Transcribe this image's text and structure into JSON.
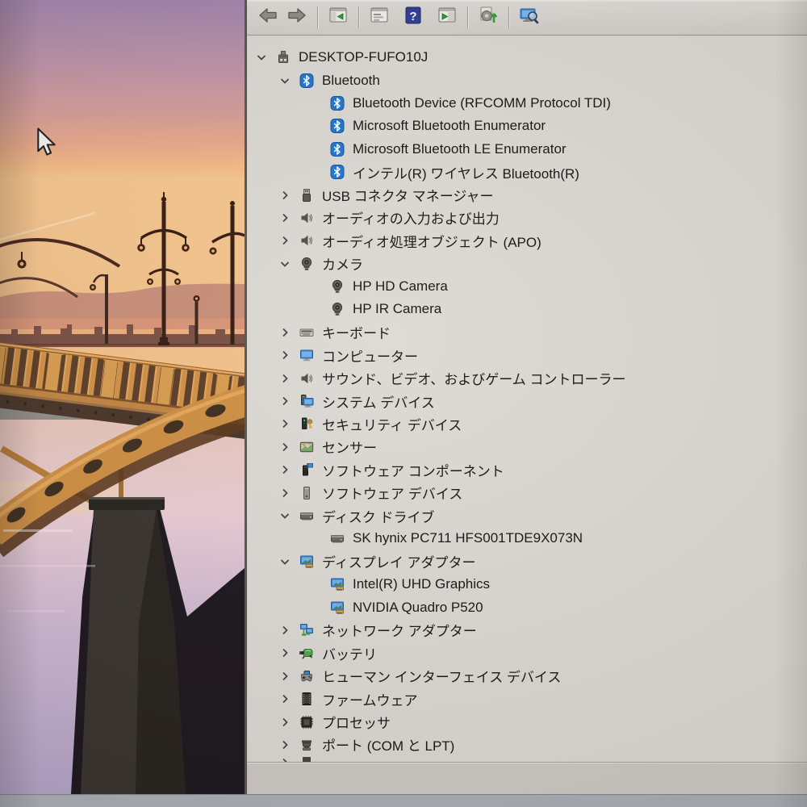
{
  "window": {
    "app": "device-manager"
  },
  "colors": {
    "bluetooth_blue": "#1b74cf",
    "monitor_blue": "#3584d6",
    "help_blue": "#2d3a96",
    "battery_green": "#4aa84a",
    "tree_background": "#dcd9d4"
  },
  "toolbar": {
    "items": [
      {
        "type": "button",
        "name": "back-button",
        "icon": "arrow-left"
      },
      {
        "type": "button",
        "name": "forward-button",
        "icon": "arrow-right"
      },
      {
        "type": "sep"
      },
      {
        "type": "button",
        "name": "console-tree-button",
        "icon": "console-tree"
      },
      {
        "type": "sep"
      },
      {
        "type": "button",
        "name": "properties-button",
        "icon": "properties-window"
      },
      {
        "type": "button",
        "name": "help-button",
        "icon": "help"
      },
      {
        "type": "button",
        "name": "action-pane-button",
        "icon": "action-pane"
      },
      {
        "type": "sep"
      },
      {
        "type": "button",
        "name": "scan-hardware-button",
        "icon": "scan-hardware"
      },
      {
        "type": "sep"
      },
      {
        "type": "button",
        "name": "search-computer-button",
        "icon": "search-computer"
      }
    ]
  },
  "tree": {
    "computer_name": "DESKTOP-FUFO10J",
    "rows": [
      {
        "level": 0,
        "state": "expanded",
        "icon": "computer-root",
        "label": "DESKTOP-FUFO10J"
      },
      {
        "level": 1,
        "state": "expanded",
        "icon": "bluetooth",
        "label": "Bluetooth"
      },
      {
        "level": 2,
        "state": "leaf",
        "icon": "bluetooth",
        "label": "Bluetooth Device (RFCOMM Protocol TDI)"
      },
      {
        "level": 2,
        "state": "leaf",
        "icon": "bluetooth",
        "label": "Microsoft Bluetooth Enumerator"
      },
      {
        "level": 2,
        "state": "leaf",
        "icon": "bluetooth",
        "label": "Microsoft Bluetooth LE Enumerator"
      },
      {
        "level": 2,
        "state": "leaf",
        "icon": "bluetooth",
        "label": "インテル(R) ワイヤレス Bluetooth(R)"
      },
      {
        "level": 1,
        "state": "collapsed",
        "icon": "usb",
        "label": "USB コネクタ マネージャー"
      },
      {
        "level": 1,
        "state": "collapsed",
        "icon": "audio",
        "label": "オーディオの入力および出力"
      },
      {
        "level": 1,
        "state": "collapsed",
        "icon": "audio",
        "label": "オーディオ処理オブジェクト (APO)"
      },
      {
        "level": 1,
        "state": "expanded",
        "icon": "camera",
        "label": "カメラ"
      },
      {
        "level": 2,
        "state": "leaf",
        "icon": "camera",
        "label": "HP HD Camera"
      },
      {
        "level": 2,
        "state": "leaf",
        "icon": "camera",
        "label": "HP IR Camera"
      },
      {
        "level": 1,
        "state": "collapsed",
        "icon": "keyboard",
        "label": "キーボード"
      },
      {
        "level": 1,
        "state": "collapsed",
        "icon": "computer",
        "label": "コンピューター"
      },
      {
        "level": 1,
        "state": "collapsed",
        "icon": "audio",
        "label": "サウンド、ビデオ、およびゲーム コントローラー"
      },
      {
        "level": 1,
        "state": "collapsed",
        "icon": "system",
        "label": "システム デバイス"
      },
      {
        "level": 1,
        "state": "collapsed",
        "icon": "security",
        "label": "セキュリティ デバイス"
      },
      {
        "level": 1,
        "state": "collapsed",
        "icon": "sensor",
        "label": "センサー"
      },
      {
        "level": 1,
        "state": "collapsed",
        "icon": "software-component",
        "label": "ソフトウェア コンポーネント"
      },
      {
        "level": 1,
        "state": "collapsed",
        "icon": "software-device",
        "label": "ソフトウェア デバイス"
      },
      {
        "level": 1,
        "state": "expanded",
        "icon": "disk",
        "label": "ディスク ドライブ"
      },
      {
        "level": 2,
        "state": "leaf",
        "icon": "disk",
        "label": "SK hynix PC711 HFS001TDE9X073N"
      },
      {
        "level": 1,
        "state": "expanded",
        "icon": "display",
        "label": "ディスプレイ アダプター"
      },
      {
        "level": 2,
        "state": "leaf",
        "icon": "display",
        "label": "Intel(R) UHD Graphics"
      },
      {
        "level": 2,
        "state": "leaf",
        "icon": "display",
        "label": "NVIDIA Quadro P520"
      },
      {
        "level": 1,
        "state": "collapsed",
        "icon": "network",
        "label": "ネットワーク アダプター"
      },
      {
        "level": 1,
        "state": "collapsed",
        "icon": "battery",
        "label": "バッテリ"
      },
      {
        "level": 1,
        "state": "collapsed",
        "icon": "hid",
        "label": "ヒューマン インターフェイス デバイス"
      },
      {
        "level": 1,
        "state": "collapsed",
        "icon": "firmware",
        "label": "ファームウェア"
      },
      {
        "level": 1,
        "state": "collapsed",
        "icon": "processor",
        "label": "プロセッサ"
      },
      {
        "level": 1,
        "state": "collapsed",
        "icon": "ports",
        "label": "ポート (COM と LPT)"
      },
      {
        "level": 1,
        "state": "collapsed",
        "icon": "partial",
        "label": "",
        "partial": true
      }
    ]
  }
}
